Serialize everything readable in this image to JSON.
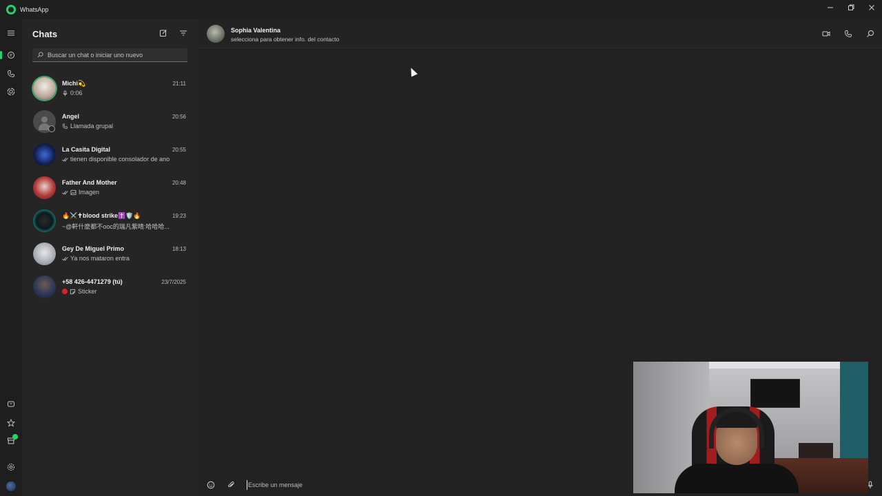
{
  "window": {
    "title": "WhatsApp",
    "controls": [
      "minimize-icon",
      "restore-icon",
      "close-icon"
    ]
  },
  "rail": {
    "top_items": [
      "menu-icon",
      "chats-icon",
      "calls-icon",
      "status-icon"
    ],
    "bottom_items": [
      "meta-ai-icon",
      "starred-icon",
      "archived-icon",
      "settings-icon",
      "profile-avatar"
    ],
    "active": "chats-icon"
  },
  "sidebar": {
    "title": "Chats",
    "search_placeholder": "Buscar un chat o iniciar uno nuevo",
    "chats": [
      {
        "name": "Michi💫",
        "time": "21:11",
        "preview": "0:06",
        "preview_icon": "mic-icon",
        "avatar": "photo",
        "story_ring": true
      },
      {
        "name": "Angel",
        "time": "20:56",
        "preview": "Llamada grupal",
        "preview_icon": "group-call-icon",
        "avatar": "default",
        "story_ring": false
      },
      {
        "name": "La Casita Digital",
        "time": "20:55",
        "preview": "tienen disponible consolador de ano",
        "preview_icon": "double-check-icon",
        "avatar": "photo",
        "story_ring": false
      },
      {
        "name": "Father And Mother",
        "time": "20:48",
        "preview": "Imagen",
        "preview_icon": "image-icon",
        "avatar": "photo",
        "story_ring": false
      },
      {
        "name": "🔥⚔️✝blood strike✝️🛡️🔥",
        "time": "19:23",
        "preview": "~@軒什麼都不ooc的瑞凡紫晴:哈哈哈...",
        "preview_icon": "",
        "avatar": "photo",
        "story_ring": false
      },
      {
        "name": "Gey De Miguel Primo",
        "time": "18:13",
        "preview": "Ya nos mataron entra",
        "preview_icon": "double-check-icon",
        "avatar": "photo",
        "story_ring": false
      },
      {
        "name": "+58 426-4471279 (tú)",
        "time": "23/7/2025",
        "preview": "Sticker",
        "preview_icon": "sticker-icon",
        "avatar": "photo",
        "story_ring": false
      }
    ]
  },
  "conversation": {
    "contact_name": "Sophia Valentina",
    "contact_subtitle": "selecciona para obtener info. del contacto",
    "composer_placeholder": "Escribe un mensaje"
  },
  "colors": {
    "accent": "#25d366",
    "background": "#222222",
    "sidebar": "#252525"
  }
}
